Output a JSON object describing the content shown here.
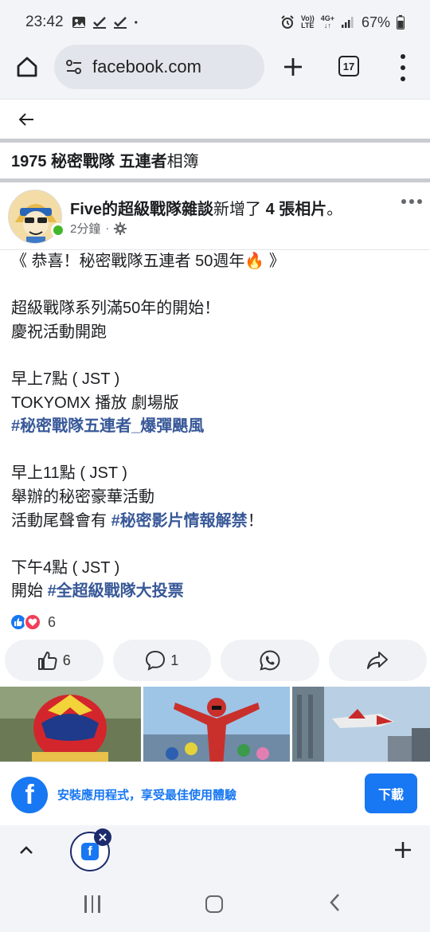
{
  "status_bar": {
    "time": "23:42",
    "vol": "Vo))",
    "lte": "LTE",
    "net": "4G+",
    "battery": "67%"
  },
  "browser": {
    "url": "facebook.com",
    "tab_count": "17"
  },
  "page": {
    "album_title_bold": "1975 秘密戰隊 五連者",
    "album_title_suffix": "相簿"
  },
  "post": {
    "author": "Five的超級戰隊雜談",
    "action_prefix": "新增了 ",
    "photo_count": "4 張相片",
    "action_suffix": "。",
    "time": "2分鐘",
    "dot": "·",
    "lines": {
      "l1": "《 恭喜！秘密戰隊五連者 50週年🔥 》",
      "l2": "超級戰隊系列滿50年的開始！",
      "l3": "慶祝活動開跑",
      "l4": "早上7點 ( JST )",
      "l5": "TOKYOMX 播放 劇場版",
      "l6_tag": "#秘密戰隊五連者_爆彈颶風",
      "l7": "早上11點 ( JST )",
      "l8": "舉辦的秘密豪華活動",
      "l9_prefix": "活動尾聲會有 ",
      "l9_tag": "#秘密影片情報解禁",
      "l9_suffix": "！",
      "l10": "下午4點 ( JST )",
      "l11_prefix": "開始 ",
      "l11_tag": "#全超級戰隊大投票"
    },
    "reaction_count": "6",
    "actions": {
      "like_count": "6",
      "comment_count": "1"
    }
  },
  "banner": {
    "text": "安裝應用程式，享受最佳使用體驗",
    "download": "下載"
  },
  "colors": {
    "fb_blue": "#1877f2",
    "hashtag": "#385898",
    "love_red": "#f33e58",
    "online_green": "#42b72a"
  }
}
